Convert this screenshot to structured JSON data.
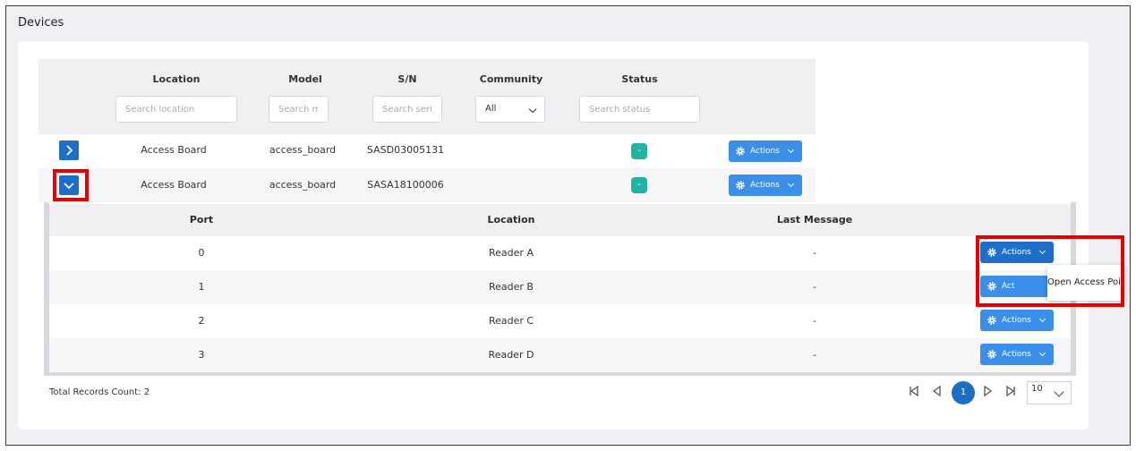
{
  "page": {
    "title": "Devices"
  },
  "table": {
    "headers": {
      "location": "Location",
      "model": "Model",
      "sn": "S/N",
      "community": "Community",
      "status": "Status"
    },
    "filters": {
      "location_placeholder": "Search location",
      "model_placeholder": "Search mo",
      "sn_placeholder": "Search seri",
      "community_value": "All",
      "status_placeholder": "Search status"
    },
    "rows": [
      {
        "location": "Access Board",
        "model": "access_board",
        "sn": "SASD03005131",
        "status": "-",
        "actions": "Actions"
      },
      {
        "location": "Access Board",
        "model": "access_board",
        "sn": "SASA18100006",
        "status": "-",
        "actions": "Actions"
      }
    ]
  },
  "subtable": {
    "headers": {
      "port": "Port",
      "location": "Location",
      "last_message": "Last Message"
    },
    "rows": [
      {
        "port": "0",
        "location": "Reader A",
        "last_message": "-",
        "actions": "Actions"
      },
      {
        "port": "1",
        "location": "Reader B",
        "last_message": "-",
        "actions": "Act"
      },
      {
        "port": "2",
        "location": "Reader C",
        "last_message": "-",
        "actions": "Actions"
      },
      {
        "port": "3",
        "location": "Reader D",
        "last_message": "-",
        "actions": "Actions"
      }
    ]
  },
  "popup": {
    "item": "Open Access Point"
  },
  "footer": {
    "total_count": "Total Records Count: 2",
    "current_page": "1",
    "page_size": "10"
  },
  "colors": {
    "primary": "#1d6fc6",
    "button": "#3b8fe8",
    "status": "#22b3a5",
    "highlight": "#e60000"
  }
}
